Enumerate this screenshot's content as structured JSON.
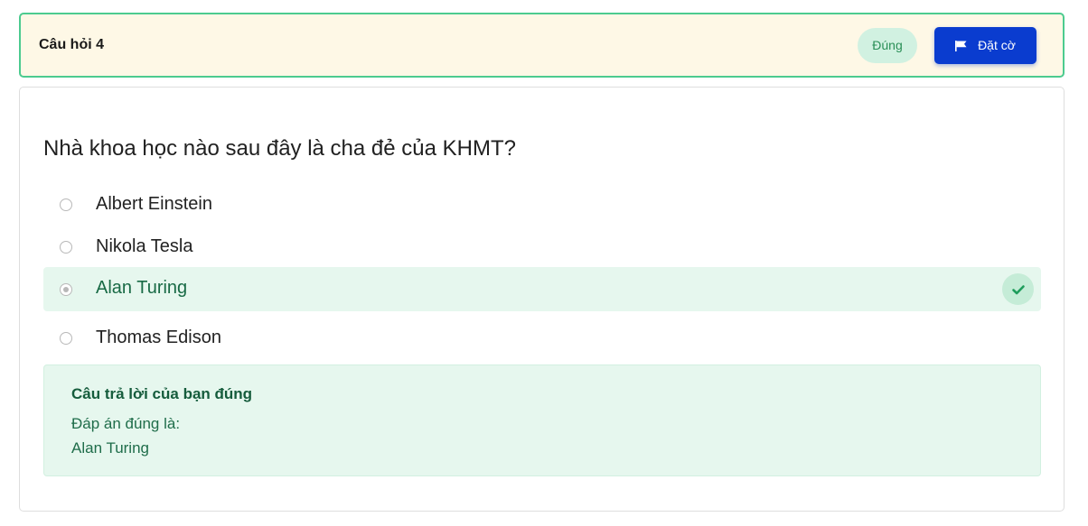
{
  "header": {
    "question_label": "Câu hỏi 4",
    "status_badge": "Đúng",
    "flag_button_label": "Đặt cờ"
  },
  "question": {
    "text": "Nhà khoa học nào sau đây là cha đẻ của KHMT?",
    "options": [
      {
        "label": "Albert Einstein",
        "selected": false,
        "correct": false
      },
      {
        "label": "Nikola Tesla",
        "selected": false,
        "correct": false
      },
      {
        "label": "Alan Turing",
        "selected": true,
        "correct": true
      },
      {
        "label": "Thomas Edison",
        "selected": false,
        "correct": false
      }
    ]
  },
  "feedback": {
    "title": "Câu trả lời của bạn đúng",
    "correct_answer_label": "Đáp án đúng là:",
    "correct_answer": "Alan Turing"
  },
  "colors": {
    "header_bg": "#fef8e6",
    "header_border": "#4ccb8f",
    "accent": "#0a3ccf",
    "correct_bg": "#e6f7ee",
    "correct_text": "#186a45"
  },
  "icons": {
    "flag": "flag-icon",
    "check": "check-icon",
    "radio": "radio-icon"
  }
}
